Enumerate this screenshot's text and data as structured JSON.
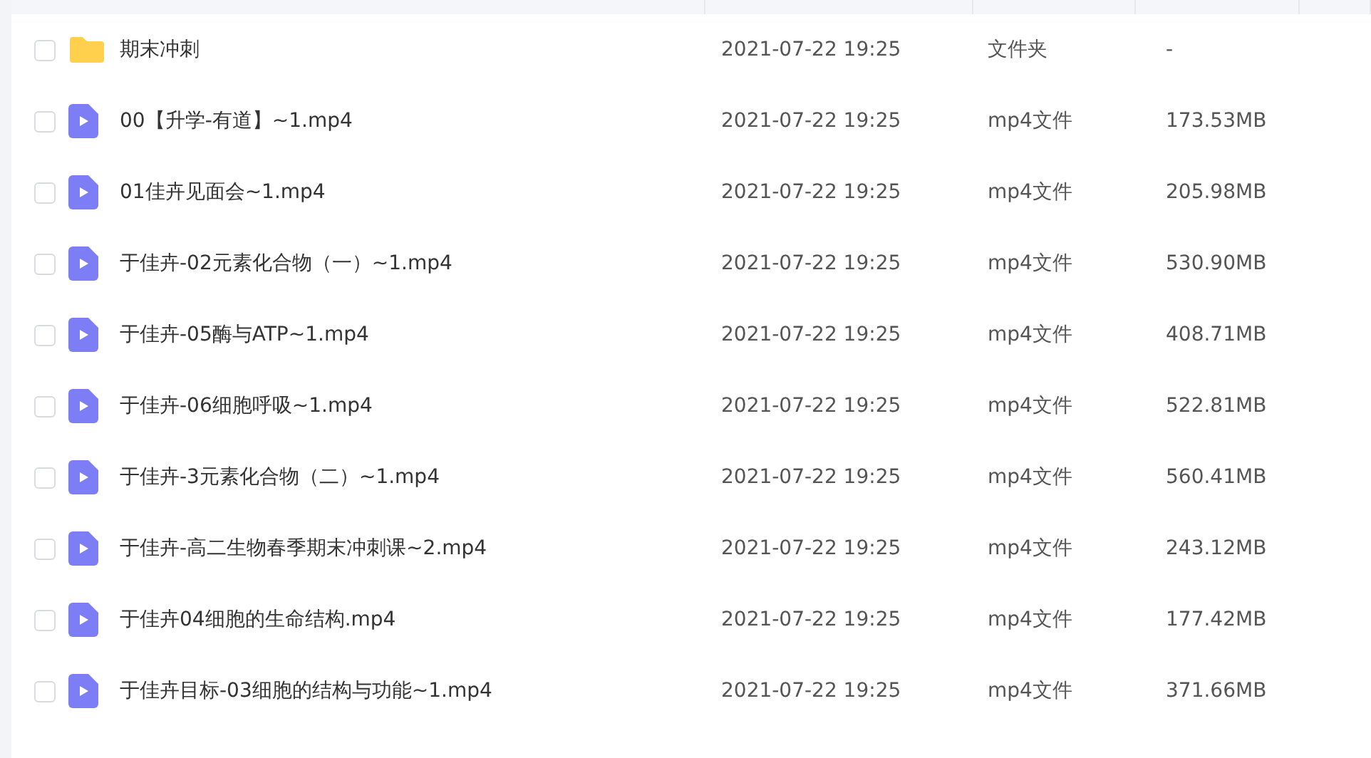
{
  "files": [
    {
      "kind": "folder",
      "checked": false,
      "name": "期末冲刺",
      "modified": "2021-07-22 19:25",
      "type": "文件夹",
      "size": "-"
    },
    {
      "kind": "video",
      "checked": false,
      "name": "00【升学-有道】~1.mp4",
      "modified": "2021-07-22 19:25",
      "type": "mp4文件",
      "size": "173.53MB"
    },
    {
      "kind": "video",
      "checked": false,
      "name": "01佳卉见面会~1.mp4",
      "modified": "2021-07-22 19:25",
      "type": "mp4文件",
      "size": "205.98MB"
    },
    {
      "kind": "video",
      "checked": false,
      "name": "于佳卉-02元素化合物（一）~1.mp4",
      "modified": "2021-07-22 19:25",
      "type": "mp4文件",
      "size": "530.90MB"
    },
    {
      "kind": "video",
      "checked": false,
      "name": "于佳卉-05酶与ATP~1.mp4",
      "modified": "2021-07-22 19:25",
      "type": "mp4文件",
      "size": "408.71MB"
    },
    {
      "kind": "video",
      "checked": false,
      "name": "于佳卉-06细胞呼吸~1.mp4",
      "modified": "2021-07-22 19:25",
      "type": "mp4文件",
      "size": "522.81MB"
    },
    {
      "kind": "video",
      "checked": false,
      "name": "于佳卉-3元素化合物（二）~1.mp4",
      "modified": "2021-07-22 19:25",
      "type": "mp4文件",
      "size": "560.41MB"
    },
    {
      "kind": "video",
      "checked": false,
      "name": "于佳卉-高二生物春季期末冲刺课~2.mp4",
      "modified": "2021-07-22 19:25",
      "type": "mp4文件",
      "size": "243.12MB"
    },
    {
      "kind": "video",
      "checked": false,
      "name": "于佳卉04细胞的生命结构.mp4",
      "modified": "2021-07-22 19:25",
      "type": "mp4文件",
      "size": "177.42MB"
    },
    {
      "kind": "video",
      "checked": false,
      "name": "于佳卉目标-03细胞的结构与功能~1.mp4",
      "modified": "2021-07-22 19:25",
      "type": "mp4文件",
      "size": "371.66MB"
    }
  ]
}
